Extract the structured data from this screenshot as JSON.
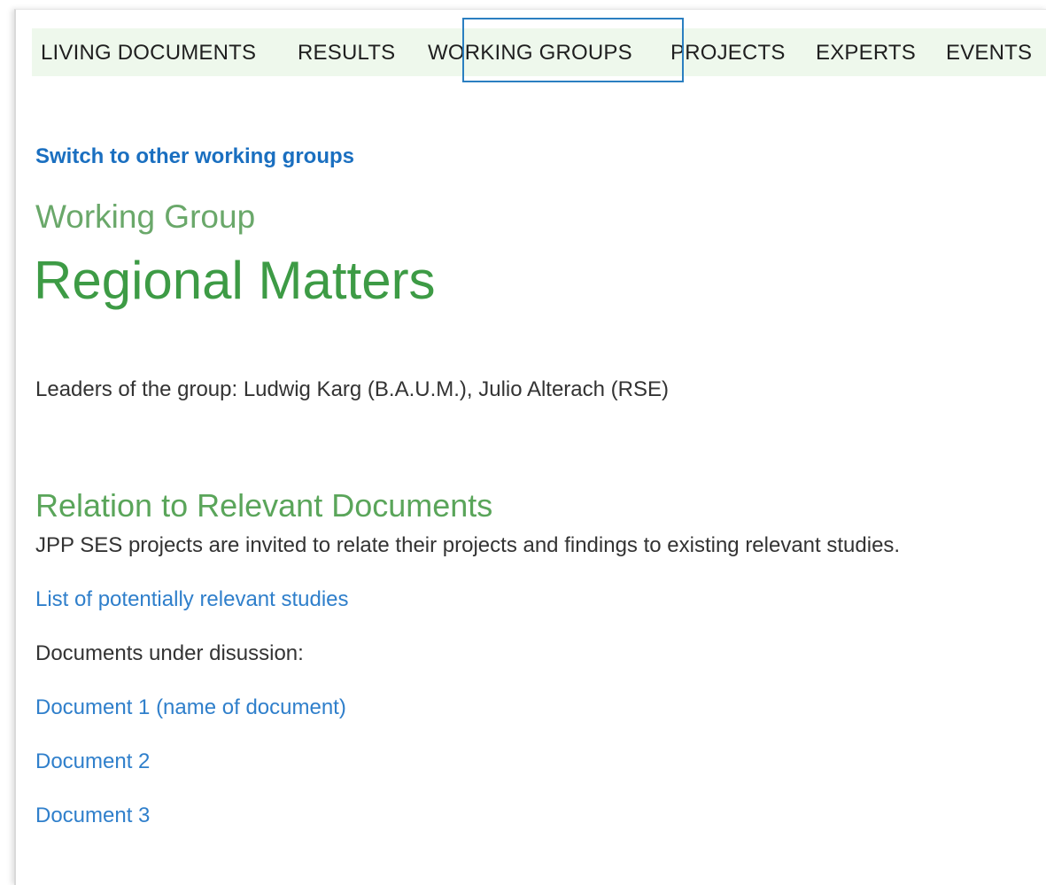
{
  "nav": {
    "items": [
      {
        "label": "LIVING DOCUMENTS"
      },
      {
        "label": "RESULTS"
      },
      {
        "label": "WORKING GROUPS",
        "active": true
      },
      {
        "label": "PROJECTS"
      },
      {
        "label": "EXPERTS"
      },
      {
        "label": "EVENTS"
      }
    ]
  },
  "switch_link": "Switch to other working groups",
  "group": {
    "kicker": "Working Group",
    "title": "Regional Matters",
    "leaders": "Leaders of the group: Ludwig Karg (B.A.U.M.), Julio Alterach (RSE)"
  },
  "relation": {
    "heading": "Relation to Relevant Documents",
    "description": "JPP SES projects are invited to relate their projects and findings to existing relevant studies.",
    "studies_link": "List of potentially relevant studies",
    "discussion_label": "Documents under disussion:",
    "documents": [
      {
        "label": "Document 1 (name of document)"
      },
      {
        "label": "Document 2"
      },
      {
        "label": "Document 3"
      }
    ]
  },
  "colors": {
    "nav_background": "#eef8ec",
    "highlight_border": "#2b7fc1",
    "title_green": "#3d9b45",
    "link_blue": "#2f7fcb"
  }
}
